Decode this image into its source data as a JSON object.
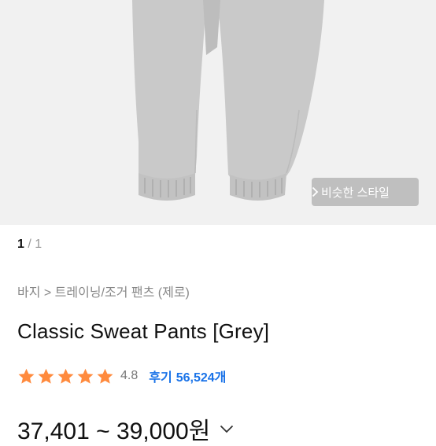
{
  "gallery": {
    "current_page": "1",
    "separator": "/",
    "total_pages": "1",
    "similar_style_label": "비슷한 스타일",
    "background_color": "#f1f1f1",
    "product_color": "#c9c9c9"
  },
  "product": {
    "breadcrumb": "바지 > 트레이닝/조거 팬츠 (제로)",
    "title": "Classic Sweat Pants [Grey]",
    "rating": {
      "stars_value": 4.8,
      "stars_max": 5,
      "score_text": "4.8",
      "reviews_label": "후기",
      "reviews_count": "56,524개"
    },
    "price": {
      "text": "37,401 ~ 39,000원"
    },
    "star_color": "#ff8a3d",
    "review_link_color": "#1a73e8"
  }
}
